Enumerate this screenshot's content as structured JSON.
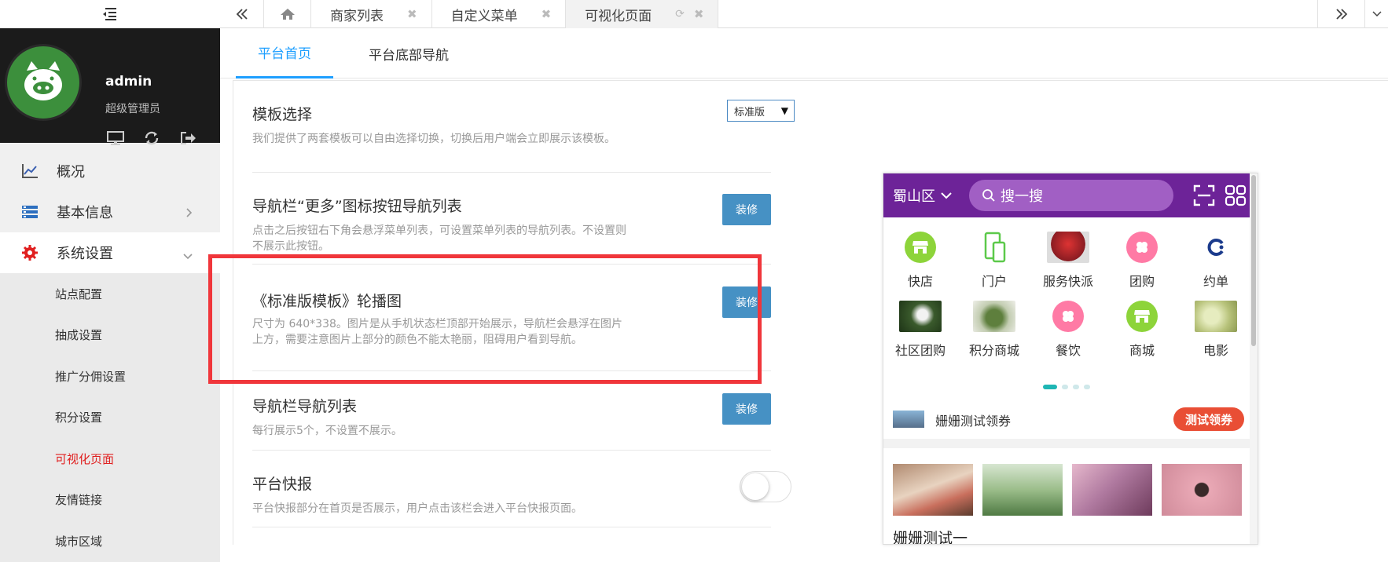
{
  "sidebar": {
    "user": {
      "name": "admin",
      "role": "超级管理员"
    },
    "menu": [
      {
        "label": "概况",
        "icon": "line-chart-icon"
      },
      {
        "label": "基本信息",
        "icon": "server-icon"
      },
      {
        "label": "系统设置",
        "icon": "gear-icon"
      }
    ],
    "submenu": [
      "站点配置",
      "抽成设置",
      "推广分佣设置",
      "积分设置",
      "可视化页面",
      "友情链接",
      "城市区域"
    ]
  },
  "tabs": [
    "商家列表",
    "自定义菜单",
    "可视化页面"
  ],
  "subtabs": [
    "平台首页",
    "平台底部导航"
  ],
  "settings": {
    "template": {
      "title": "模板选择",
      "desc": "我们提供了两套模板可以自由选择切换，切换后用户端会立即展示该模板。",
      "select_value": "标准版"
    },
    "more_nav": {
      "title": "导航栏“更多”图标按钮导航列表",
      "desc": "点击之后按钮右下角会悬浮菜单列表，可设置菜单列表的导航列表。不设置则不展示此按钮。",
      "button": "装修"
    },
    "carousel": {
      "title": "《标准版模板》轮播图",
      "desc": "尺寸为 640*338。图片是从手机状态栏顶部开始展示，导航栏会悬浮在图片上方，需要注意图片上部分的颜色不能太艳丽，阻碍用户看到导航。",
      "button": "装修"
    },
    "nav_list": {
      "title": "导航栏导航列表",
      "desc": "每行展示5个，不设置不展示。",
      "button": "装修"
    },
    "flash": {
      "title": "平台快报",
      "desc": "平台快报部分在首页是否展示，用户点击该栏会进入平台快报页面。",
      "enabled": false
    }
  },
  "phone": {
    "location": "蜀山区",
    "search_placeholder": "搜一搜",
    "grid": [
      {
        "label": "快店",
        "kind": "icon",
        "color": "#8dd43a",
        "icon": "shop-icon"
      },
      {
        "label": "门户",
        "kind": "icon",
        "color": "#ffffff",
        "icon": "phone-portal-icon"
      },
      {
        "label": "服务快派",
        "kind": "photo",
        "color": "#c9323a"
      },
      {
        "label": "团购",
        "kind": "icon",
        "color": "#ff7aa5",
        "icon": "clover-icon"
      },
      {
        "label": "约单",
        "kind": "icon",
        "color": "#ffffff",
        "icon": "c-logo-icon"
      },
      {
        "label": "社区团购",
        "kind": "photo",
        "color": "#3a5a2c"
      },
      {
        "label": "积分商城",
        "kind": "photo",
        "color": "#8aa06a"
      },
      {
        "label": "餐饮",
        "kind": "icon",
        "color": "#ff7aa5",
        "icon": "clover-icon"
      },
      {
        "label": "商城",
        "kind": "icon",
        "color": "#8dd43a",
        "icon": "shop-icon"
      },
      {
        "label": "电影",
        "kind": "photo",
        "color": "#c5cf8f"
      }
    ],
    "coupon": {
      "title": "姗姗测试领券",
      "button": "测试领券"
    },
    "photos": [
      "#d9b9a0",
      "#9bbd8a",
      "#b07aa0",
      "#e9a8b5"
    ],
    "section_title": "姗姗测试一"
  }
}
